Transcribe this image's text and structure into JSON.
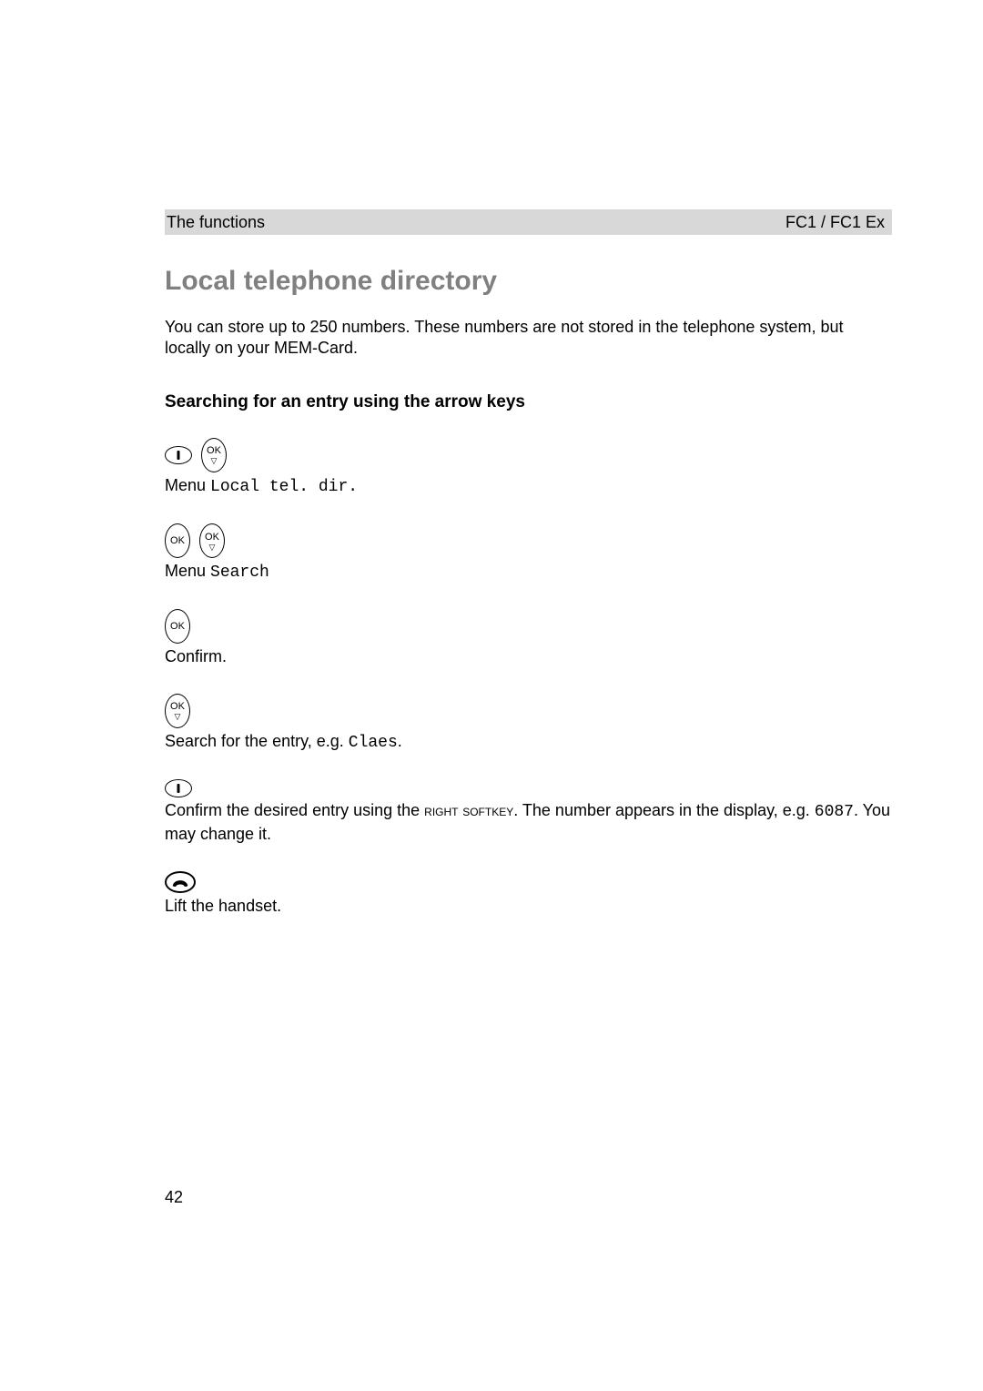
{
  "header": {
    "left": "The functions",
    "right": "FC1 / FC1 Ex"
  },
  "section_title": "Local telephone directory",
  "intro_text": "You can store up to 250 numbers. These numbers are not stored in the telephone system, but locally on your MEM-Card.",
  "subsection_title": "Searching for an entry using the arrow keys",
  "steps": {
    "step1": {
      "prefix": "Menu ",
      "mono": "Local tel. dir."
    },
    "step2": {
      "prefix": "Menu ",
      "mono": "Search"
    },
    "step3": {
      "text": "Confirm."
    },
    "step4": {
      "prefix": "Search for the entry, e.g. ",
      "mono": "Claes",
      "suffix": "."
    },
    "step5": {
      "part1": "Confirm the desired entry using the ",
      "smallcaps": "right softkey",
      "part2": ". The number appears in the display, e.g. ",
      "mono": "6087",
      "part3": ". You may change it."
    },
    "step6": {
      "text": "Lift the handset."
    }
  },
  "icon_labels": {
    "ok": "OK"
  },
  "page_number": "42"
}
